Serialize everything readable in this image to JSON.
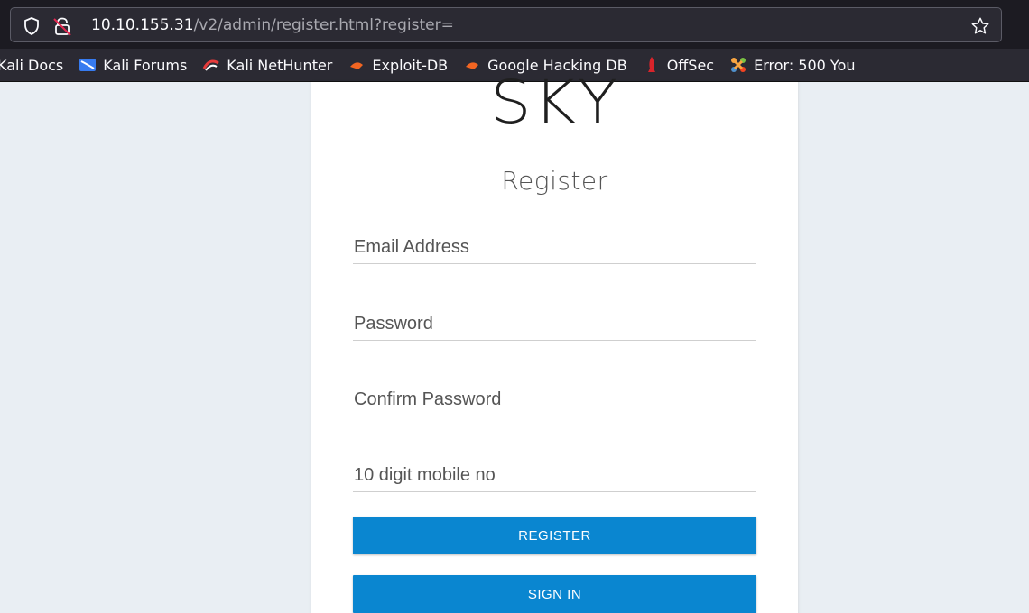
{
  "browser": {
    "url_host": "10.10.155.31",
    "url_path": "/v2/admin/register.html?register=",
    "bookmarks": [
      {
        "label": "Kali Docs",
        "icon": "kali-docs-icon"
      },
      {
        "label": "Kali Forums",
        "icon": "kali-forums-icon"
      },
      {
        "label": "Kali NetHunter",
        "icon": "kali-nethunter-icon"
      },
      {
        "label": "Exploit-DB",
        "icon": "exploit-db-icon"
      },
      {
        "label": "Google Hacking DB",
        "icon": "google-hacking-db-icon"
      },
      {
        "label": "OffSec",
        "icon": "offsec-icon"
      },
      {
        "label": "Error: 500 You",
        "icon": "joomla-icon"
      }
    ]
  },
  "page": {
    "logo": "SKY",
    "heading": "Register",
    "fields": {
      "email_placeholder": "Email Address",
      "password_placeholder": "Password",
      "confirm_placeholder": "Confirm Password",
      "mobile_placeholder": "10 digit mobile no"
    },
    "register_button": "REGISTER",
    "signin_button": "SIGN IN"
  },
  "colors": {
    "accent": "#0a86d0",
    "page_bg": "#e9eef3",
    "chrome_bg": "#2b2a33"
  }
}
